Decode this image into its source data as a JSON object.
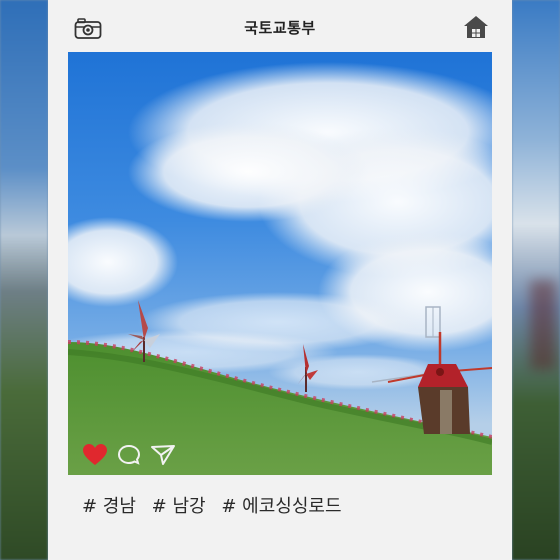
{
  "header": {
    "title": "국토교통부",
    "camera_icon": "camera-icon",
    "home_icon": "home-icon"
  },
  "post": {
    "actions": [
      "heart-icon",
      "comment-icon",
      "share-icon"
    ],
    "liked_color": "#e0282e",
    "hashtags": [
      "# 경남",
      "# 남강",
      "# 에코싱싱로드"
    ]
  }
}
